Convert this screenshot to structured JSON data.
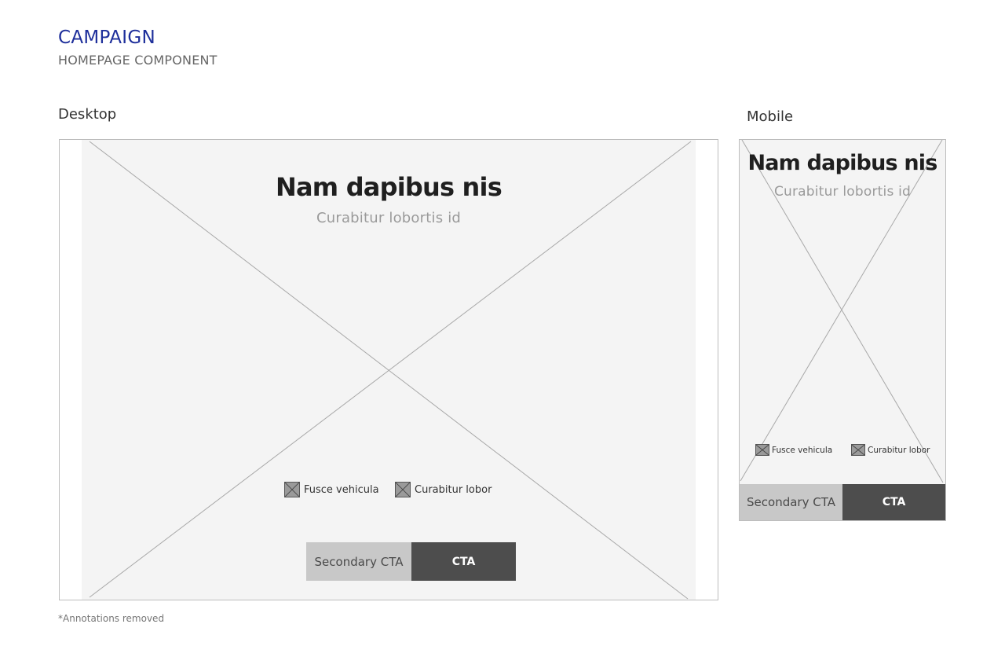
{
  "header": {
    "title": "CAMPAIGN",
    "subtitle": "HOMEPAGE COMPONENT"
  },
  "desktop": {
    "label": "Desktop",
    "heading": "Nam dapibus nis",
    "subheading": "Curabitur lobortis id",
    "features": [
      {
        "icon": "image-placeholder-icon",
        "label": "Fusce vehicula"
      },
      {
        "icon": "image-placeholder-icon",
        "label": "Curabitur lobor"
      }
    ],
    "secondary_cta": "Secondary CTA",
    "primary_cta": "CTA"
  },
  "mobile": {
    "label": "Mobile",
    "heading": "Nam dapibus nis",
    "subheading": "Curabitur lobortis id",
    "features": [
      {
        "icon": "image-placeholder-icon",
        "label": "Fusce vehicula"
      },
      {
        "icon": "image-placeholder-icon",
        "label": "Curabitur lobor"
      }
    ],
    "secondary_cta": "Secondary CTA",
    "primary_cta": "CTA"
  },
  "footnote": "*Annotations removed",
  "colors": {
    "title": "#1e2f9b",
    "hero_background": "#f4f4f4",
    "primary_cta": "#4d4d4d",
    "secondary_cta": "#c8c8c8"
  }
}
